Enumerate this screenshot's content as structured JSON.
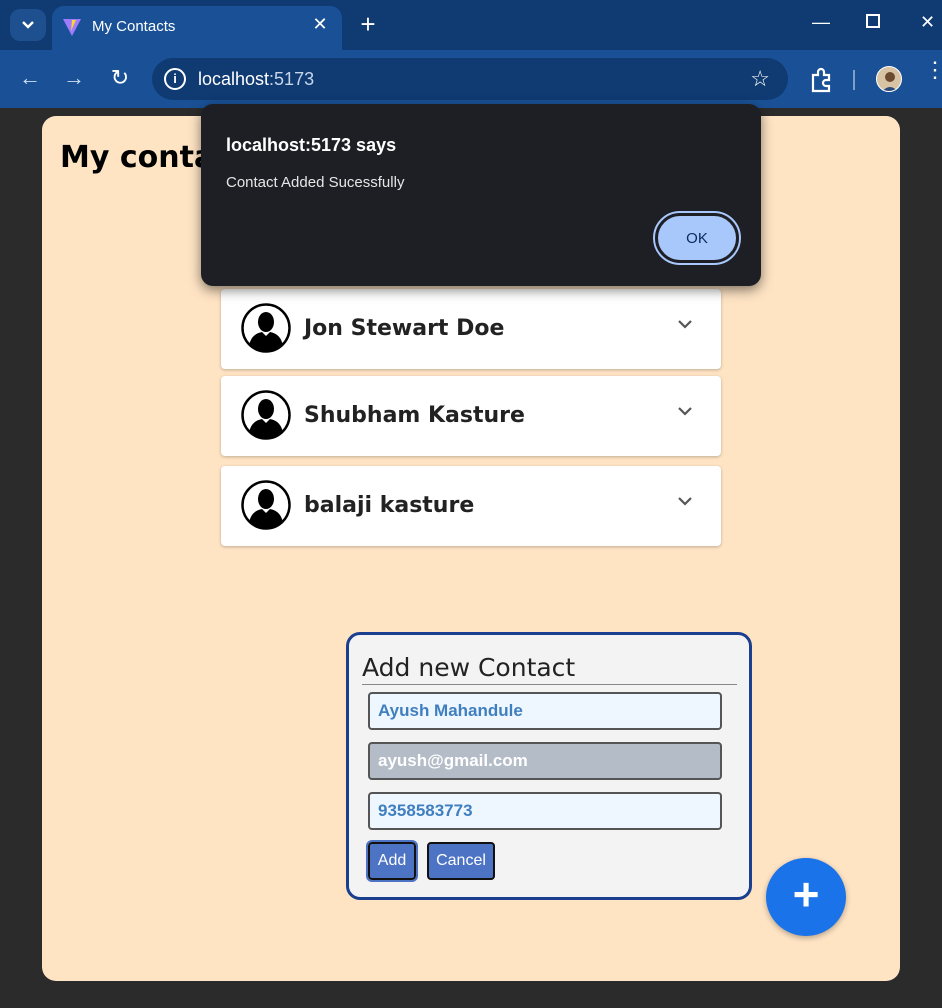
{
  "browser": {
    "tab_title": "My Contacts",
    "url_host": "localhost",
    "url_port": ":5173"
  },
  "page": {
    "title": "My contacts"
  },
  "contacts": [
    {
      "name": "Jon Stewart Doe"
    },
    {
      "name": "Shubham Kasture"
    },
    {
      "name": "balaji kasture"
    }
  ],
  "form": {
    "heading": "Add new Contact",
    "name_value": "Ayush Mahandule",
    "email_value": "ayush@gmail.com",
    "phone_value": "9358583773",
    "add_label": "Add",
    "cancel_label": "Cancel"
  },
  "fab": {
    "label": "+"
  },
  "alert": {
    "title": "localhost:5173 says",
    "message": "Contact Added Sucessfully",
    "ok_label": "OK"
  },
  "colors": {
    "page_bg": "#ffe4c4",
    "accent": "#1a73e8",
    "form_border": "#1a3f8f",
    "button": "#4d73c4"
  }
}
